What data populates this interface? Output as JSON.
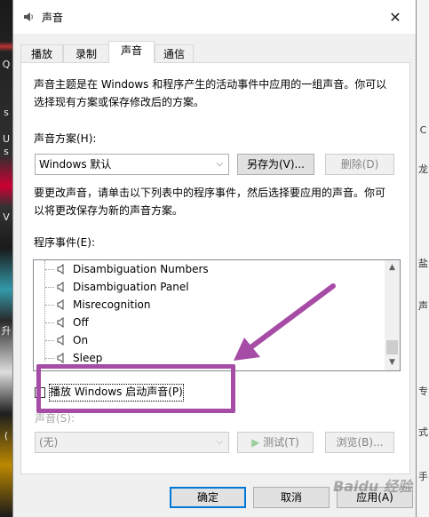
{
  "window": {
    "title": "声音",
    "close_glyph": "✕"
  },
  "tabs": [
    {
      "label": "播放"
    },
    {
      "label": "录制"
    },
    {
      "label": "声音"
    },
    {
      "label": "通信"
    }
  ],
  "panel": {
    "intro_line1": "声音主题是在 Windows 和程序产生的活动事件中应用的一组声音。你可以",
    "intro_line2": "选择现有方案或保存修改后的方案。",
    "scheme_label": "声音方案(H):",
    "scheme_value": "Windows 默认",
    "save_as_label": "另存为(V)...",
    "delete_label": "删除(D)",
    "help_line1": "要更改声音，请单击以下列表中的程序事件，然后选择要应用的声音。你可",
    "help_line2": "以将更改保存为新的声音方案。",
    "events_label": "程序事件(E):",
    "events": [
      "Disambiguation Numbers",
      "Disambiguation Panel",
      "Misrecognition",
      "Off",
      "On",
      "Sleep"
    ],
    "startup_checkbox_label": "播放 Windows 启动声音(P)",
    "startup_checked": false,
    "sounds_label": "声音(S):",
    "sounds_value": "(无)",
    "test_label": "测试(T)",
    "browse_label": "浏览(B)..."
  },
  "footer": {
    "ok_label": "确定",
    "cancel_label": "取消",
    "apply_label": "应用(A)"
  },
  "watermark": "Baidu 经验",
  "background": {
    "left_fragments": [
      "Q",
      "s",
      "U",
      "s",
      "V",
      "升",
      "("
    ],
    "right_fragments": [
      "C",
      "龙",
      "盐",
      "声",
      "专",
      "式",
      "手"
    ]
  },
  "colors": {
    "annotation": "#a64ca6",
    "accent": "#0078d7"
  }
}
